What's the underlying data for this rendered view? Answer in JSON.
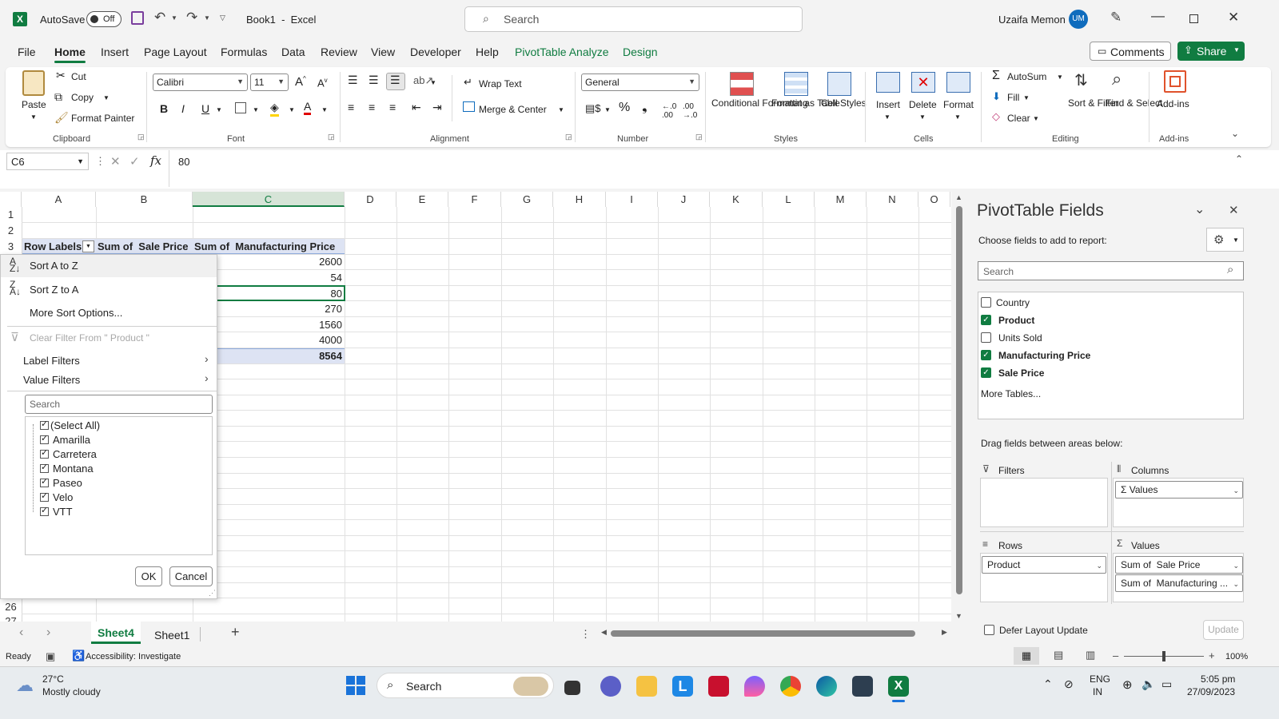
{
  "titlebar": {
    "autosave_label": "AutoSave",
    "autosave_state": "Off",
    "title": "Book1  -  Excel",
    "search_placeholder": "Search",
    "user_name": "Uzaifa Memon",
    "user_initials": "UM"
  },
  "menu": {
    "tabs": [
      "File",
      "Home",
      "Insert",
      "Page Layout",
      "Formulas",
      "Data",
      "Review",
      "View",
      "Developer",
      "Help",
      "PivotTable Analyze",
      "Design"
    ],
    "comments": "Comments",
    "share": "Share"
  },
  "ribbon": {
    "clipboard": {
      "paste": "Paste",
      "cut": "Cut",
      "copy": "Copy",
      "format_painter": "Format Painter",
      "label": "Clipboard"
    },
    "font": {
      "name": "Calibri",
      "size": "11",
      "label": "Font",
      "bold": "B",
      "italic": "I",
      "underline": "U"
    },
    "alignment": {
      "wrap": "Wrap Text",
      "merge": "Merge & Center",
      "label": "Alignment"
    },
    "number": {
      "format": "General",
      "label": "Number"
    },
    "styles": {
      "conditional": "Conditional Formatting",
      "format_table": "Format as Table",
      "cell_styles": "Cell Styles",
      "label": "Styles"
    },
    "cells": {
      "insert": "Insert",
      "delete": "Delete",
      "format": "Format",
      "label": "Cells"
    },
    "editing": {
      "autosum": "AutoSum",
      "fill": "Fill",
      "clear": "Clear",
      "sort": "Sort & Filter",
      "find": "Find & Select",
      "label": "Editing"
    },
    "addins": {
      "addins": "Add-ins",
      "label": "Add-ins"
    }
  },
  "formula_bar": {
    "name_box": "C6",
    "fx": "fx",
    "value": "80"
  },
  "grid": {
    "columns": [
      "A",
      "B",
      "C",
      "D",
      "E",
      "F",
      "G",
      "H",
      "I",
      "J",
      "K",
      "L",
      "M",
      "N",
      "O"
    ],
    "rows_top": [
      "1",
      "2",
      "3"
    ],
    "row_bottom": "26",
    "row_partial": "27",
    "header_row": {
      "a": "Row Labels",
      "b": "Sum of  Sale Price",
      "c": "Sum of  Manufacturing Price"
    },
    "c_values": [
      "2600",
      "54",
      "80",
      "270",
      "1560",
      "4000"
    ],
    "grand_total": "8564"
  },
  "filter_popup": {
    "sort_az": "Sort A to Z",
    "sort_za": "Sort Z to A",
    "more_sort": "More Sort Options...",
    "clear_filter": "Clear Filter From \" Product \"",
    "label_filters": "Label Filters",
    "value_filters": "Value Filters",
    "search_placeholder": "Search",
    "items": [
      "(Select All)",
      "Amarilla",
      "Carretera",
      "Montana",
      "Paseo",
      "Velo",
      "VTT"
    ],
    "ok": "OK",
    "cancel": "Cancel"
  },
  "sheets": {
    "tabs": [
      "Sheet4",
      "Sheet1"
    ],
    "active": "Sheet4"
  },
  "status": {
    "ready": "Ready",
    "accessibility": "Accessibility: Investigate",
    "zoom": "100%"
  },
  "pivot_pane": {
    "title": "PivotTable Fields",
    "choose": "Choose fields to add to report:",
    "search_placeholder": "Search",
    "fields": [
      {
        "name": "Country",
        "checked": false
      },
      {
        "name": "Product",
        "checked": true
      },
      {
        "name": "Units Sold",
        "checked": false
      },
      {
        "name": "Manufacturing Price",
        "checked": true
      },
      {
        "name": "Sale Price",
        "checked": true
      }
    ],
    "more_tables": "More Tables...",
    "drag": "Drag fields between areas below:",
    "filters": "Filters",
    "columns": "Columns",
    "columns_item": "Σ Values",
    "rows": "Rows",
    "rows_item": "Product",
    "values": "Values",
    "values_items": [
      "Sum of  Sale Price",
      "Sum of  Manufacturing ..."
    ],
    "defer": "Defer Layout Update",
    "update": "Update"
  },
  "taskbar": {
    "temp": "27°C",
    "weather": "Mostly cloudy",
    "search": "Search",
    "lang1": "ENG",
    "lang2": "IN",
    "time": "5:05 pm",
    "date": "27/09/2023"
  },
  "colors": {
    "excel_green": "#107c41",
    "selection": "#dde3f3",
    "accent_blue": "#0f6cbd"
  }
}
